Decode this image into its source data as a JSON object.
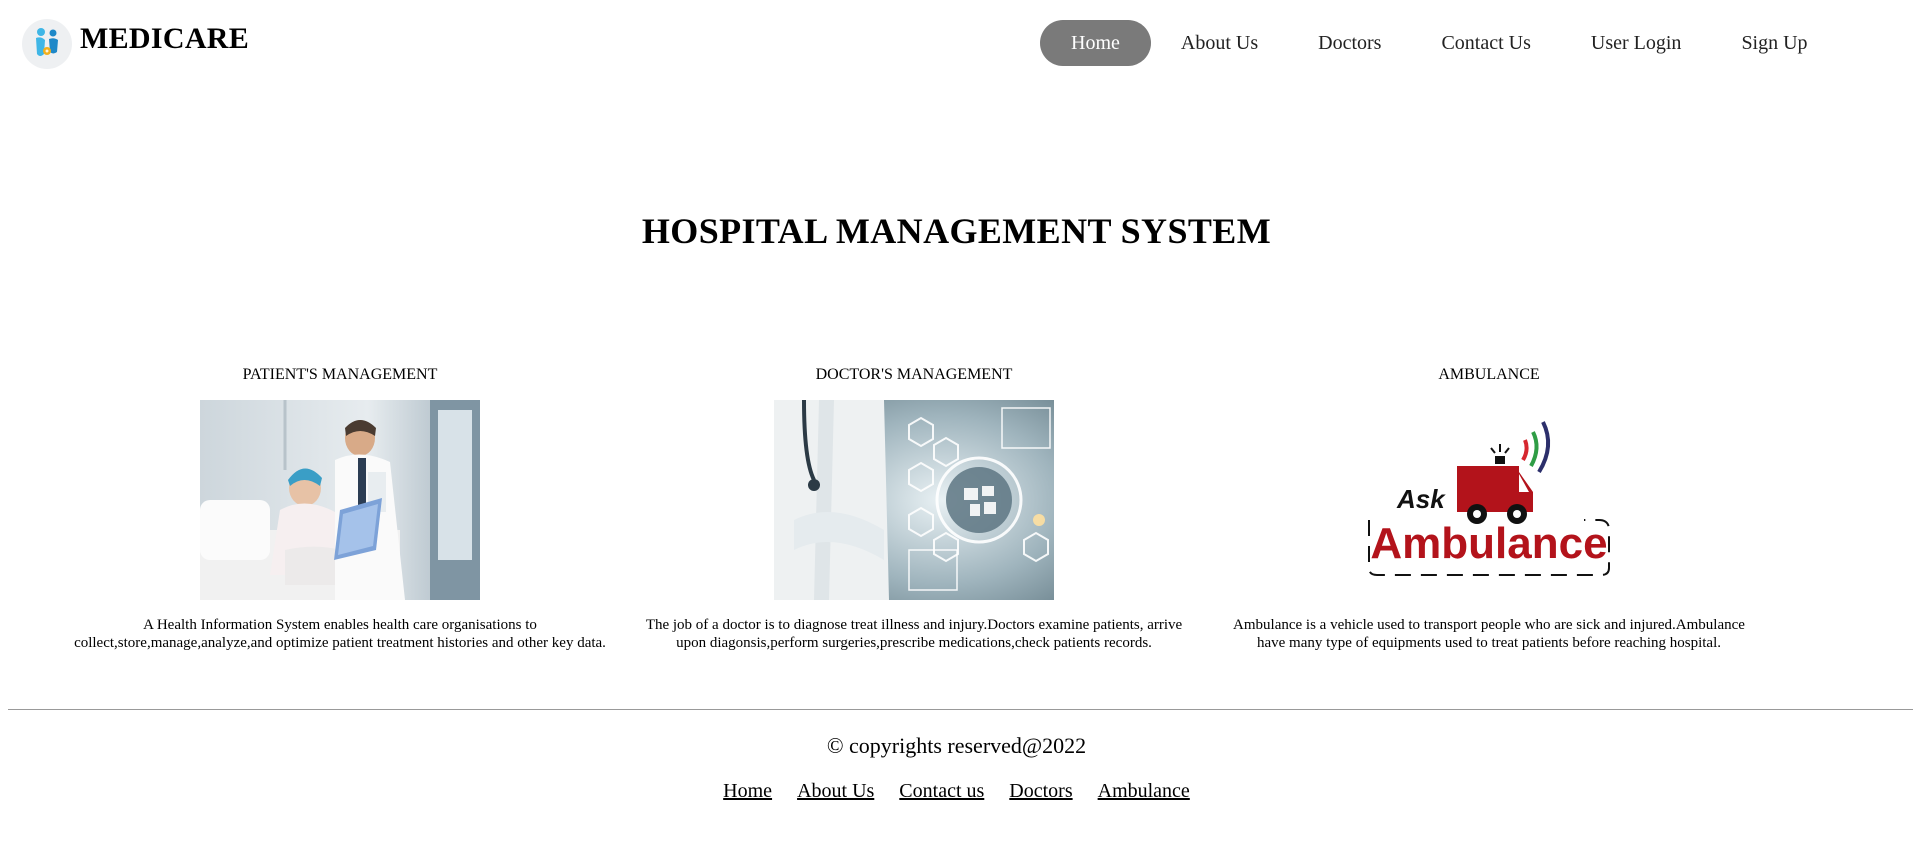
{
  "header": {
    "brand": "MEDICARE",
    "logo_icon": "family-health-logo-icon",
    "nav": [
      {
        "label": "Home",
        "active": true
      },
      {
        "label": "About Us",
        "active": false
      },
      {
        "label": "Doctors",
        "active": false
      },
      {
        "label": "Contact Us",
        "active": false
      },
      {
        "label": "User Login",
        "active": false
      },
      {
        "label": "Sign Up",
        "active": false
      }
    ]
  },
  "main": {
    "title": "HOSPITAL MANAGEMENT SYSTEM",
    "cards": [
      {
        "heading": "PATIENT'S MANAGEMENT",
        "image": "doctor-with-patient-photo",
        "text": "A Health Information System enables health care organisations to collect,store,manage,analyze,and optimize patient treatment histories and other key data."
      },
      {
        "heading": "DOCTOR'S MANAGEMENT",
        "image": "doctor-digital-health-icons-photo",
        "text": "The job of a doctor is to diagnose treat illness and injury.Doctors examine patients, arrive upon diagonsis,perform surgeries,prescribe medications,check patients records."
      },
      {
        "heading": "AMBULANCE",
        "image": "ask-ambulance-logo",
        "logo_text_small": "Ask",
        "logo_text_large": "Ambulance",
        "text": "Ambulance is a vehicle used to transport people who are sick and injured.Ambulance have many type of equipments used to treat patients before reaching hospital."
      }
    ]
  },
  "footer": {
    "copyright": "© copyrights reserved@2022",
    "links": [
      "Home",
      "About Us",
      "Contact us",
      "Doctors",
      "Ambulance"
    ]
  },
  "colors": {
    "nav_active_bg": "#7a7a7a",
    "ambulance_red": "#b3131b",
    "logo_blue": "#3fb6e6"
  }
}
